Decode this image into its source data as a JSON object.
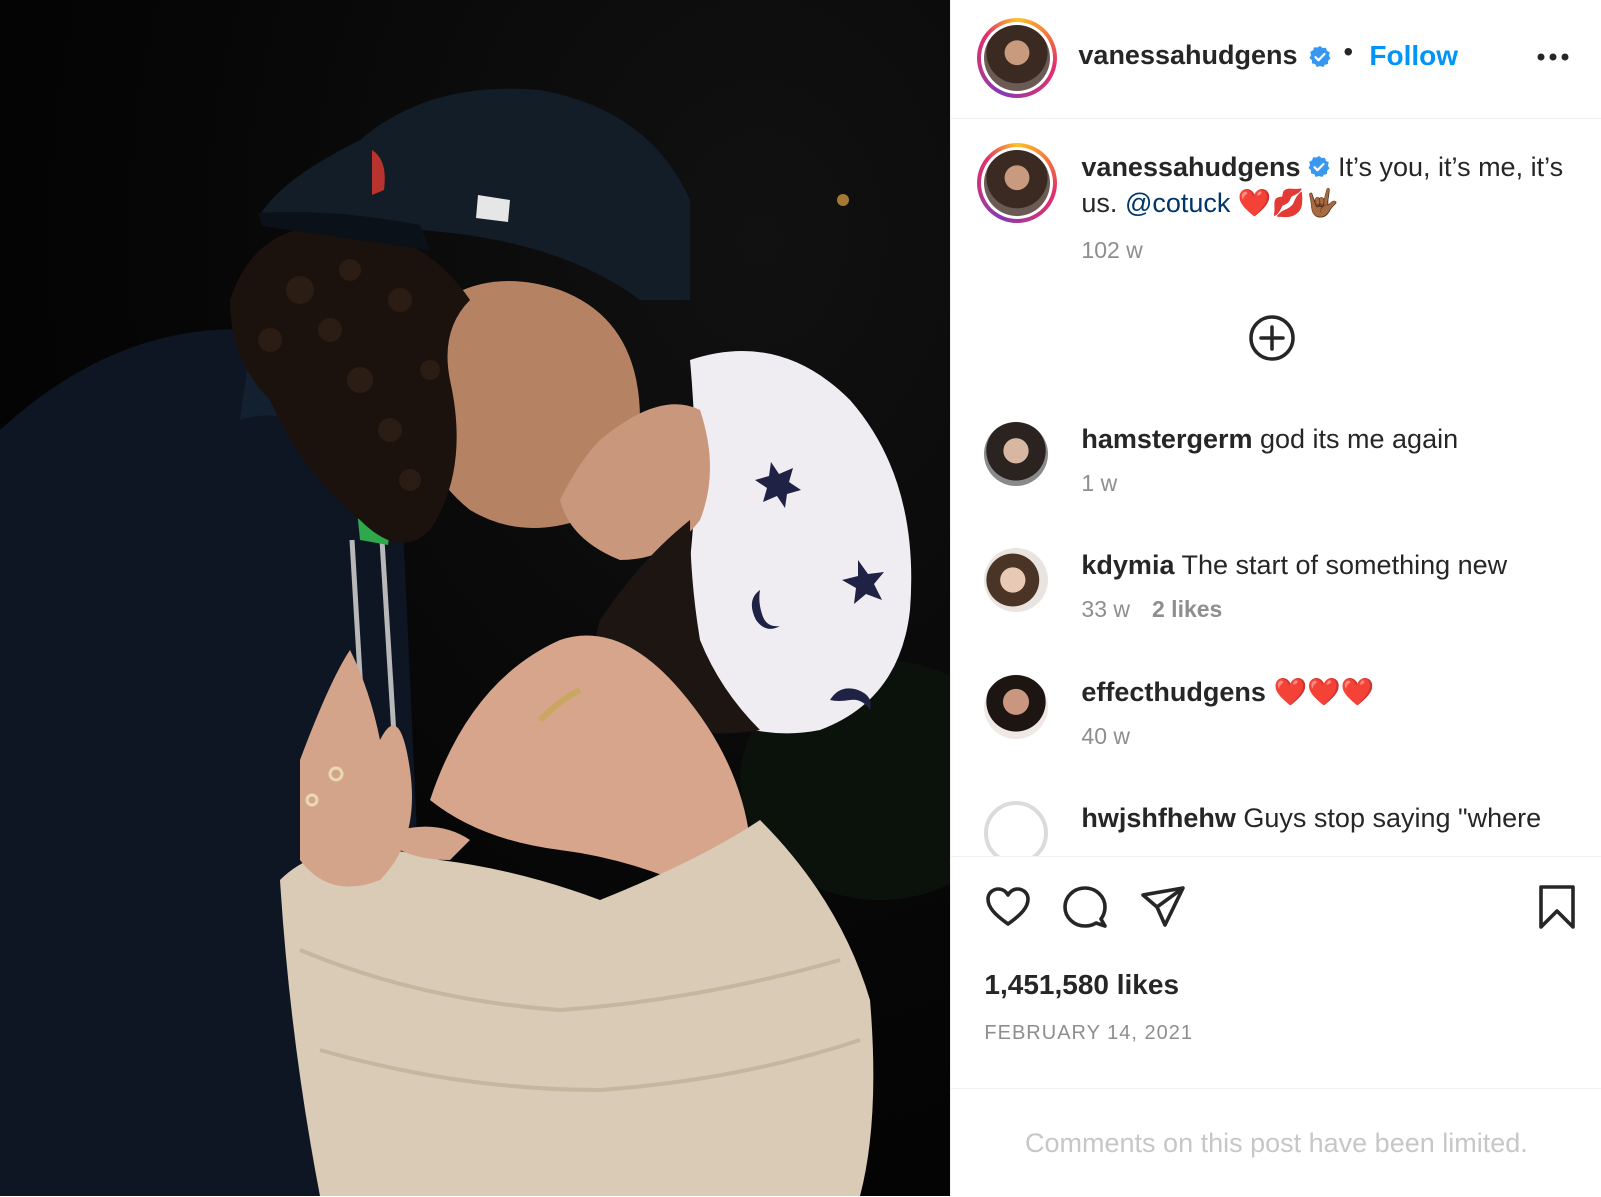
{
  "header": {
    "username": "vanessahudgens",
    "separator": "•",
    "follow_label": "Follow"
  },
  "caption": {
    "username": "vanessahudgens",
    "text_before": " It’s you, it’s me, it’s us. ",
    "mention": "@cotuck",
    "emojis": " ❤️💋🤟🏾",
    "time": "102 w"
  },
  "comments": [
    {
      "username": "hamstergerm",
      "text": " god its me again",
      "time": "1 w",
      "likes": ""
    },
    {
      "username": "kdymia",
      "text": " The start of something new",
      "time": "33 w",
      "likes": "2 likes"
    },
    {
      "username": "effecthudgens",
      "text": " ❤️❤️❤️",
      "time": "40 w",
      "likes": ""
    },
    {
      "username": "hwjshfhehw",
      "text": " Guys stop saying \"where",
      "time": "",
      "likes": ""
    }
  ],
  "stats": {
    "likes": "1,451,580 likes",
    "date": "FEBRUARY 14, 2021"
  },
  "footer": {
    "limited": "Comments on this post have been limited."
  },
  "colors": {
    "accent": "#0095f6",
    "text": "#262626",
    "muted": "#8e8e8e",
    "mention": "#00376b",
    "verified": "#3897f0"
  },
  "icons": {
    "like": "heart-icon",
    "comment": "comment-bubble-icon",
    "share": "paper-plane-icon",
    "save": "bookmark-icon",
    "more": "ellipsis-icon",
    "load_more": "plus-circle-icon",
    "verified": "verified-badge-icon"
  }
}
